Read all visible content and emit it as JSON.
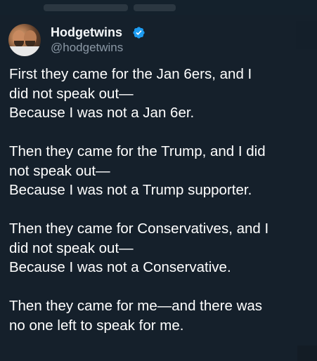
{
  "author": {
    "display_name": "Hodgetwins",
    "handle": "@hodgetwins",
    "verified": true,
    "verified_color": "#1d9bf0",
    "avatar_icon": "profile-photo"
  },
  "tweet": {
    "paragraphs": [
      {
        "lines": [
          "First they came for the Jan 6ers, and I",
          "did not speak out—",
          "Because I was not a Jan 6er."
        ]
      },
      {
        "lines": [
          "Then they came for the Trump, and I did",
          "not speak out—",
          "Because I was not a Trump supporter."
        ]
      },
      {
        "lines": [
          "Then they came for Conservatives, and I",
          "did not speak out—",
          "Because I was not a Conservative."
        ]
      },
      {
        "lines": [
          "Then they came for me—and there was",
          "no one left to speak for me."
        ]
      }
    ]
  },
  "colors": {
    "background": "#15202b",
    "text": "#ffffff",
    "secondary_text": "#8b98a5"
  }
}
